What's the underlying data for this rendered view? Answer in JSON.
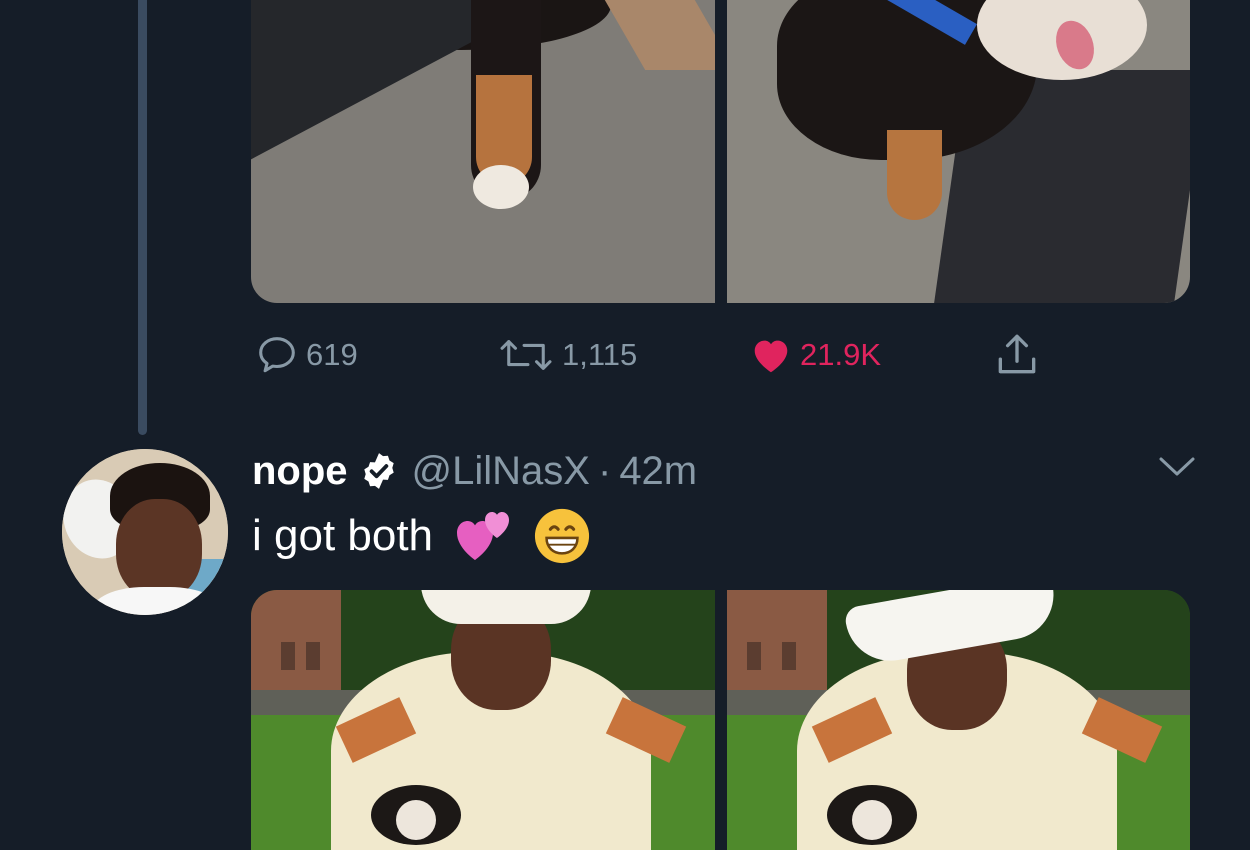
{
  "previous_tweet": {
    "media": [
      {
        "icon": "dog-photo-paw"
      },
      {
        "icon": "dog-photo-standing"
      }
    ],
    "actions": {
      "reply_count": "619",
      "retweet_count": "1,115",
      "like_count": "21.9K",
      "liked": true
    }
  },
  "tweet": {
    "display_name": "nope",
    "verified": true,
    "handle": "@LilNasX",
    "separator": "·",
    "timestamp": "42m",
    "text": "i got both",
    "emojis": [
      "two-hearts-emoji",
      "grinning-face-emoji"
    ],
    "media": [
      {
        "icon": "photo-man-cowboy-hat-with-puppy"
      },
      {
        "icon": "photo-man-cowboy-hat-with-puppy-2"
      }
    ]
  },
  "colors": {
    "background": "#151d28",
    "secondary_text": "#8899a6",
    "like_accent": "#e0245e",
    "thread_line": "#3a4b60"
  }
}
